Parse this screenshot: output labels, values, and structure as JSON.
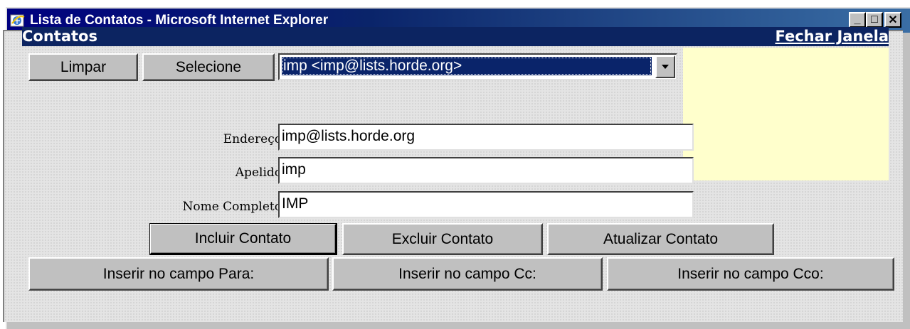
{
  "window": {
    "title": "Lista de Contatos - Microsoft Internet Explorer",
    "minimize_glyph": "_",
    "maximize_glyph": "□",
    "close_glyph": "✕"
  },
  "header": {
    "title": "Contatos",
    "close_link": "Fechar Janela"
  },
  "toolbar": {
    "clear_label": "Limpar",
    "select_label": "Selecione"
  },
  "contact_select": {
    "selected": "imp <imp@lists.horde.org>"
  },
  "form": {
    "address_label": "Endereço",
    "address_value": "imp@lists.horde.org",
    "nickname_label": "Apelido",
    "nickname_value": "imp",
    "fullname_label": "Nome Completo",
    "fullname_value": "IMP"
  },
  "actions": {
    "add_label": "Incluir Contato",
    "delete_label": "Excluir Contato",
    "update_label": "Atualizar Contato"
  },
  "insert": {
    "to_label": "Inserir no campo Para:",
    "cc_label": "Inserir no campo Cc:",
    "bcc_label": "Inserir no campo Cco:"
  },
  "colors": {
    "titlebar": "#0a246a",
    "header": "#0c2461",
    "panel": "#ffffcc",
    "selection": "#0a246a"
  },
  "icons": {
    "app": "ie-icon",
    "dropdown": "chevron-down-icon"
  }
}
